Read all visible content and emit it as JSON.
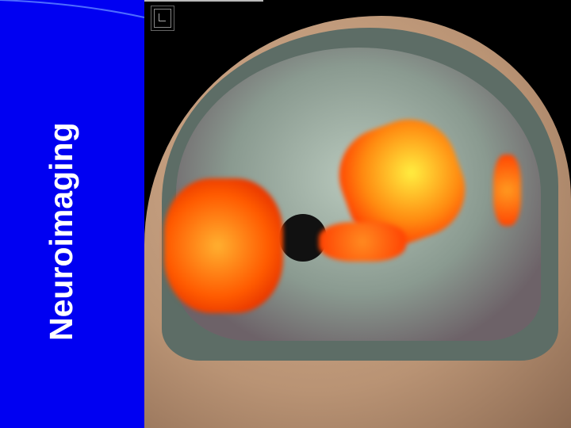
{
  "slide": {
    "title": "Neuroimaging"
  },
  "image": {
    "subject": "brain-activation-render",
    "accent_color": "#0000f2"
  }
}
